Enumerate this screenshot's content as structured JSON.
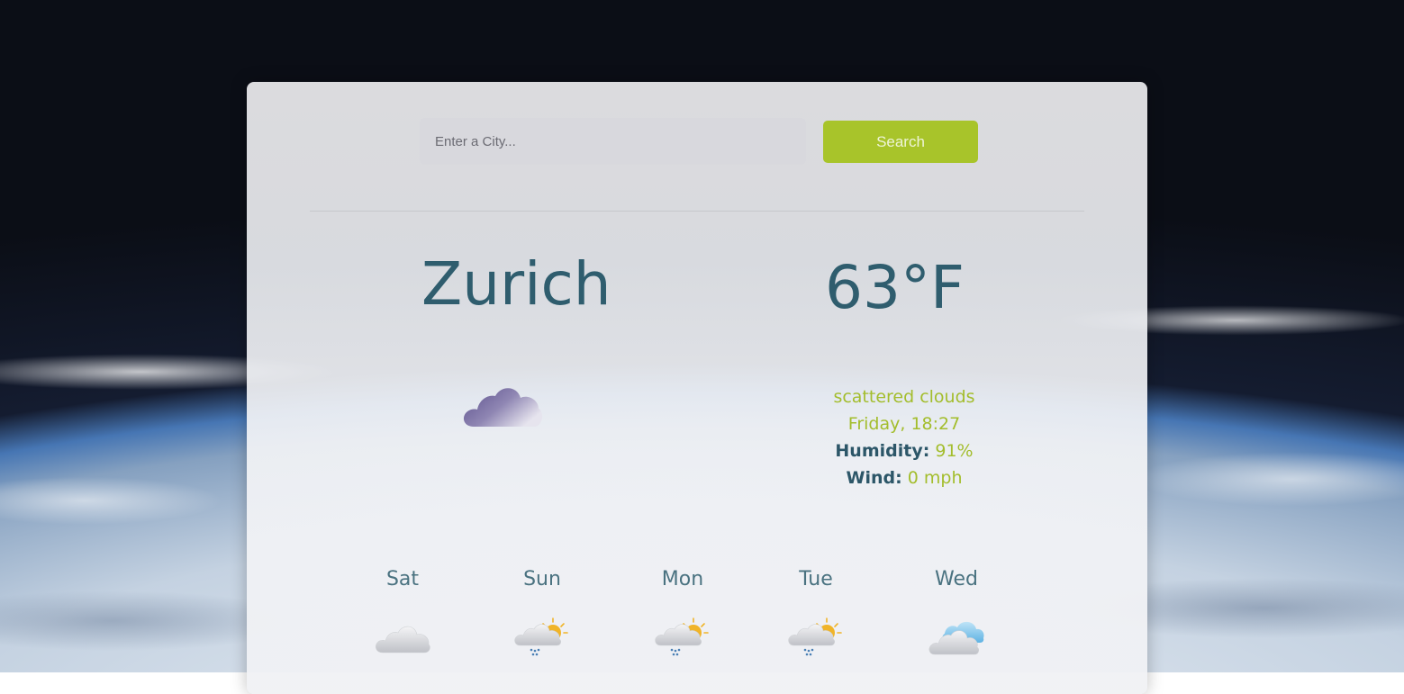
{
  "search": {
    "placeholder": "Enter a City...",
    "button_label": "Search"
  },
  "current": {
    "city": "Zurich",
    "temperature": "63°F",
    "condition": "scattered clouds",
    "datetime": "Friday, 18:27",
    "humidity_label": "Humidity:",
    "humidity_value": "91%",
    "wind_label": "Wind:",
    "wind_value": "0 mph",
    "icon": "cloud-icon"
  },
  "forecast": [
    {
      "day": "Sat",
      "icon": "cloud-icon"
    },
    {
      "day": "Sun",
      "icon": "sun-rain-cloud-icon"
    },
    {
      "day": "Mon",
      "icon": "sun-rain-cloud-icon"
    },
    {
      "day": "Tue",
      "icon": "sun-rain-cloud-icon"
    },
    {
      "day": "Wed",
      "icon": "clouds-icon"
    }
  ],
  "colors": {
    "accent": "#a8c42a",
    "primary_text": "#2f5d6e"
  }
}
